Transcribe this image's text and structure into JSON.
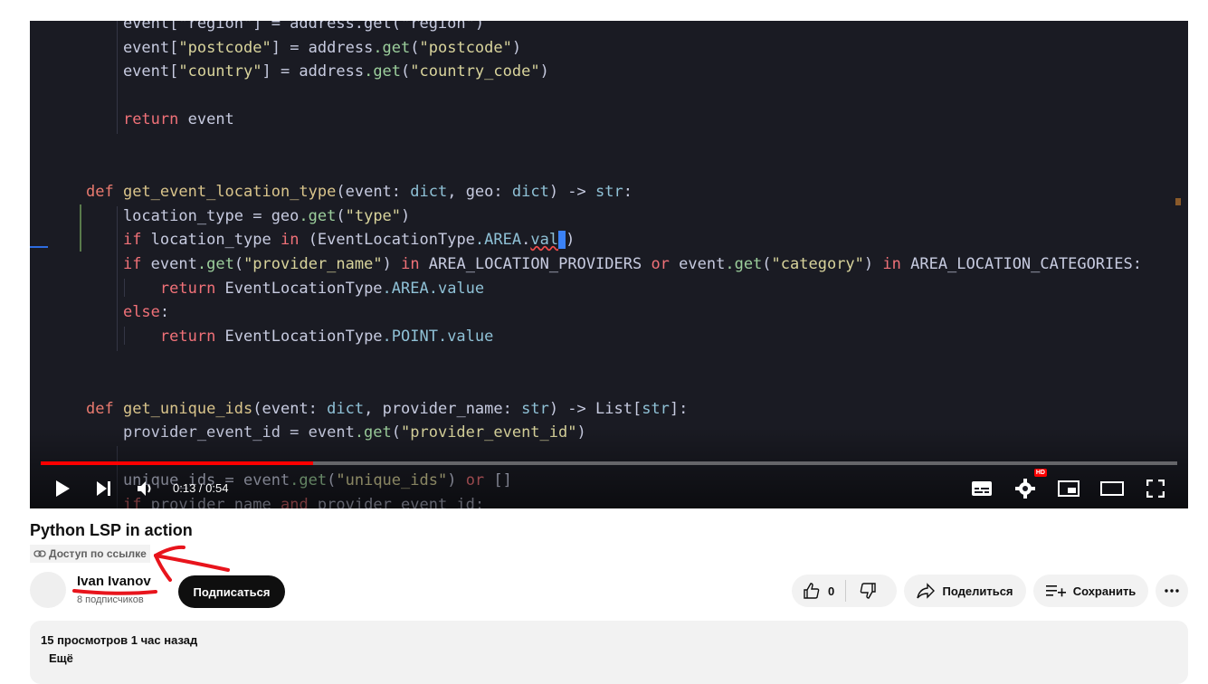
{
  "player": {
    "code_lines": [
      [
        {
          "t": "    event[\"region\"] = address.get(\"region\")",
          "c": "tok-op"
        }
      ],
      [
        {
          "t": "    event[",
          "c": "tok-op"
        },
        {
          "t": "\"postcode\"",
          "c": "tok-str"
        },
        {
          "t": "] = address",
          "c": "tok-op"
        },
        {
          "t": ".get",
          "c": "tok-mth"
        },
        {
          "t": "(",
          "c": "tok-op"
        },
        {
          "t": "\"postcode\"",
          "c": "tok-str"
        },
        {
          "t": ")",
          "c": "tok-op"
        }
      ],
      [
        {
          "t": "    event[",
          "c": "tok-op"
        },
        {
          "t": "\"country\"",
          "c": "tok-str"
        },
        {
          "t": "] = address",
          "c": "tok-op"
        },
        {
          "t": ".get",
          "c": "tok-mth"
        },
        {
          "t": "(",
          "c": "tok-op"
        },
        {
          "t": "\"country_code\"",
          "c": "tok-str"
        },
        {
          "t": ")",
          "c": "tok-op"
        }
      ],
      [],
      [
        {
          "t": "    ",
          "c": "tok-op"
        },
        {
          "t": "return",
          "c": "tok-kw"
        },
        {
          "t": " event",
          "c": "tok-op"
        }
      ],
      [],
      [],
      [
        {
          "t": "def",
          "c": "tok-def"
        },
        {
          "t": " ",
          "c": "tok-op"
        },
        {
          "t": "get_event_location_type",
          "c": "tok-fn"
        },
        {
          "t": "(event: ",
          "c": "tok-op"
        },
        {
          "t": "dict",
          "c": "tok-type"
        },
        {
          "t": ", geo: ",
          "c": "tok-op"
        },
        {
          "t": "dict",
          "c": "tok-type"
        },
        {
          "t": ") -> ",
          "c": "tok-op"
        },
        {
          "t": "str",
          "c": "tok-type"
        },
        {
          "t": ":",
          "c": "tok-op"
        }
      ],
      [
        {
          "t": "    location_type = geo",
          "c": "tok-op"
        },
        {
          "t": ".get",
          "c": "tok-mth"
        },
        {
          "t": "(",
          "c": "tok-op"
        },
        {
          "t": "\"type\"",
          "c": "tok-str"
        },
        {
          "t": ")",
          "c": "tok-op"
        }
      ],
      [
        {
          "t": "    ",
          "c": "tok-op"
        },
        {
          "t": "if",
          "c": "tok-kw"
        },
        {
          "t": " location_type ",
          "c": "tok-op"
        },
        {
          "t": "in",
          "c": "tok-kw"
        },
        {
          "t": " (EventLocationType",
          "c": "tok-op"
        },
        {
          "t": ".AREA",
          "c": "tok-attr"
        },
        {
          "t": ".",
          "c": "tok-op"
        },
        {
          "t": "val",
          "c": "tok-attr tok-err"
        },
        {
          "t": "CURSOR",
          "c": "cursor"
        },
        {
          "t": ")",
          "c": "tok-op"
        }
      ],
      [
        {
          "t": "    ",
          "c": "tok-op"
        },
        {
          "t": "if",
          "c": "tok-kw"
        },
        {
          "t": " event",
          "c": "tok-op"
        },
        {
          "t": ".get",
          "c": "tok-mth"
        },
        {
          "t": "(",
          "c": "tok-op"
        },
        {
          "t": "\"provider_name\"",
          "c": "tok-str"
        },
        {
          "t": ") ",
          "c": "tok-op"
        },
        {
          "t": "in",
          "c": "tok-kw"
        },
        {
          "t": " AREA_LOCATION_PROVIDERS ",
          "c": "tok-op"
        },
        {
          "t": "or",
          "c": "tok-kw"
        },
        {
          "t": " event",
          "c": "tok-op"
        },
        {
          "t": ".get",
          "c": "tok-mth"
        },
        {
          "t": "(",
          "c": "tok-op"
        },
        {
          "t": "\"category\"",
          "c": "tok-str"
        },
        {
          "t": ") ",
          "c": "tok-op"
        },
        {
          "t": "in",
          "c": "tok-kw"
        },
        {
          "t": " AREA_LOCATION_CATEGORIES:",
          "c": "tok-op"
        }
      ],
      [
        {
          "t": "        ",
          "c": "tok-op"
        },
        {
          "t": "return",
          "c": "tok-kw"
        },
        {
          "t": " EventLocationType",
          "c": "tok-op"
        },
        {
          "t": ".AREA.value",
          "c": "tok-attr"
        }
      ],
      [
        {
          "t": "    ",
          "c": "tok-op"
        },
        {
          "t": "else",
          "c": "tok-kw"
        },
        {
          "t": ":",
          "c": "tok-op"
        }
      ],
      [
        {
          "t": "        ",
          "c": "tok-op"
        },
        {
          "t": "return",
          "c": "tok-kw"
        },
        {
          "t": " EventLocationType",
          "c": "tok-op"
        },
        {
          "t": ".POINT.value",
          "c": "tok-attr"
        }
      ],
      [],
      [],
      [
        {
          "t": "def",
          "c": "tok-def"
        },
        {
          "t": " ",
          "c": "tok-op"
        },
        {
          "t": "get_unique_ids",
          "c": "tok-fn"
        },
        {
          "t": "(event: ",
          "c": "tok-op"
        },
        {
          "t": "dict",
          "c": "tok-type"
        },
        {
          "t": ", provider_name: ",
          "c": "tok-op"
        },
        {
          "t": "str",
          "c": "tok-type"
        },
        {
          "t": ") -> List[",
          "c": "tok-op"
        },
        {
          "t": "str",
          "c": "tok-type"
        },
        {
          "t": "]:",
          "c": "tok-op"
        }
      ],
      [
        {
          "t": "    provider_event_id = event",
          "c": "tok-op"
        },
        {
          "t": ".get",
          "c": "tok-mth"
        },
        {
          "t": "(",
          "c": "tok-op"
        },
        {
          "t": "\"provider_event_id\"",
          "c": "tok-str"
        },
        {
          "t": ")",
          "c": "tok-op"
        }
      ],
      [],
      [
        {
          "t": "    unique_ids = event",
          "c": "tok-op"
        },
        {
          "t": ".get",
          "c": "tok-mth"
        },
        {
          "t": "(",
          "c": "tok-op"
        },
        {
          "t": "\"unique_ids\"",
          "c": "tok-str"
        },
        {
          "t": ") ",
          "c": "tok-op"
        },
        {
          "t": "or",
          "c": "tok-kw"
        },
        {
          "t": " []",
          "c": "tok-op"
        }
      ],
      [
        {
          "t": "    ",
          "c": "tok-op"
        },
        {
          "t": "if",
          "c": "tok-kw"
        },
        {
          "t": " provider_name ",
          "c": "tok-op"
        },
        {
          "t": "and",
          "c": "tok-kw"
        },
        {
          "t": " provider_event_id:",
          "c": "tok-op"
        }
      ]
    ],
    "time": "0:13 / 0:54",
    "progress_fraction": 0.24,
    "hd_badge": "HD",
    "icons": [
      "play-icon",
      "next-icon",
      "volume-icon",
      "subtitles-icon",
      "settings-icon",
      "miniplayer-icon",
      "theater-icon",
      "fullscreen-icon"
    ]
  },
  "video": {
    "title": "Python LSP in action",
    "privacy": "Доступ по ссылке"
  },
  "channel": {
    "name": "Ivan Ivanov",
    "subscribers": "8 подписчиков",
    "subscribe_label": "Подписаться"
  },
  "actions": {
    "like_count": "0",
    "share_label": "Поделиться",
    "save_label": "Сохранить"
  },
  "description": {
    "stats": "15 просмотров  1 час назад",
    "more_label": "Ещё"
  },
  "annotation_color": "#e8141c"
}
